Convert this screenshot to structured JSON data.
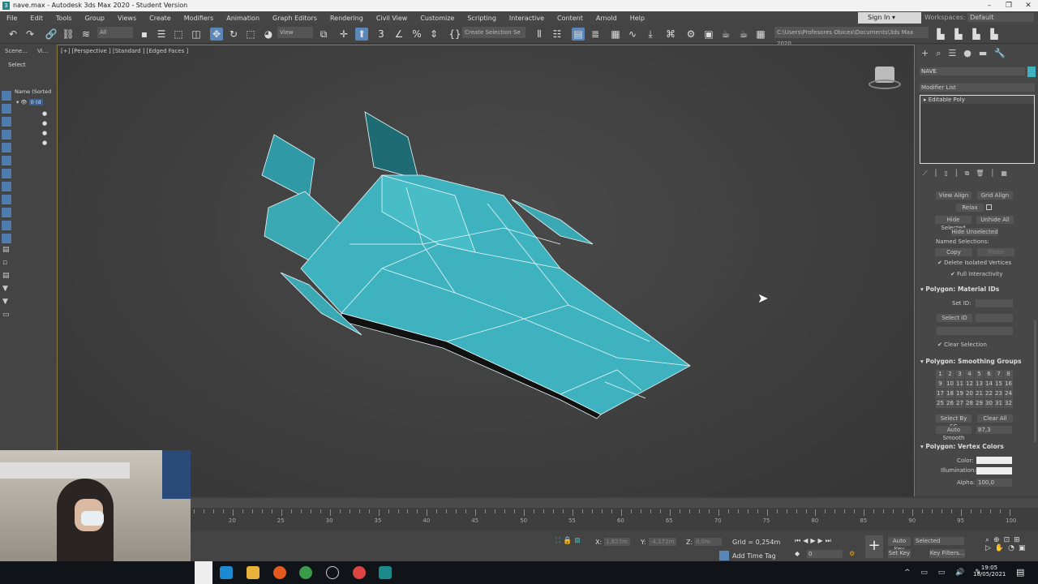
{
  "window": {
    "title": "nave.max - Autodesk 3ds Max 2020 - Student Version",
    "app_icon": "3"
  },
  "menu": [
    "File",
    "Edit",
    "Tools",
    "Group",
    "Views",
    "Create",
    "Modifiers",
    "Animation",
    "Graph Editors",
    "Rendering",
    "Civil View",
    "Customize",
    "Scripting",
    "Interactive",
    "Content",
    "Arnold",
    "Help"
  ],
  "account": {
    "sign_in": "Sign In",
    "workspaces_label": "Workspaces:",
    "workspace": "Default"
  },
  "toolbar": {
    "filter": "All",
    "ref_coord": "View",
    "selection_set": "Create Selection Se",
    "project_path": "C:\\Users\\Profesores Obicex\\Documents\\3ds Max 2020"
  },
  "left": {
    "tabs": [
      "Scene...",
      "Vi..."
    ],
    "select_label": "Select",
    "column_header": "Name (Sorted",
    "layer": "0 (d"
  },
  "viewport": {
    "label": "[+] [Perspective ] [Standard ] [Edged Faces ]",
    "object_color": "#3eb3bf"
  },
  "command_panel": {
    "object_name": "NAVE",
    "object_color": "#3eb3bf",
    "modifier_list": "Modifier List",
    "stack": [
      "Editable Poly"
    ],
    "buttons": {
      "view_align": "View Align",
      "grid_align": "Grid Align",
      "relax": "Relax",
      "hide_selected": "Hide Selected",
      "unhide_all": "Unhide All",
      "hide_unselected": "Hide Unselected",
      "named_selections": "Named Selections:",
      "copy": "Copy",
      "paste": "Paste",
      "delete_isolated": "Delete Isolated Vertices",
      "full_interactivity": "Full Interactivity"
    },
    "material_ids": {
      "title": "Polygon: Material IDs",
      "set_id": "Set ID:",
      "select_id": "Select ID",
      "clear_selection": "Clear Selection"
    },
    "smoothing": {
      "title": "Polygon: Smoothing Groups",
      "groups": [
        "1",
        "2",
        "3",
        "4",
        "5",
        "6",
        "7",
        "8",
        "9",
        "10",
        "11",
        "12",
        "13",
        "14",
        "15",
        "16",
        "17",
        "18",
        "19",
        "20",
        "21",
        "22",
        "23",
        "24",
        "25",
        "26",
        "27",
        "28",
        "29",
        "30",
        "31",
        "32"
      ],
      "select_by_sg": "Select By SG",
      "clear_all": "Clear All",
      "auto_smooth": "Auto Smooth",
      "auto_smooth_value": "87,3"
    },
    "vertex_colors": {
      "title": "Polygon: Vertex Colors",
      "color": "Color:",
      "illumination": "Illumination:",
      "alpha": "Alpha:",
      "alpha_value": "100,0"
    }
  },
  "timeline": {
    "ticks": [
      "20",
      "25",
      "30",
      "35",
      "40",
      "45",
      "50",
      "55",
      "60",
      "65",
      "70",
      "75",
      "80",
      "85",
      "90",
      "95",
      "100"
    ]
  },
  "status": {
    "x_label": "X:",
    "x": "1,827m",
    "y_label": "Y:",
    "y": "-4,172m",
    "z_label": "Z:",
    "z": "0,0m",
    "grid": "Grid = 0,254m",
    "add_time_tag": "Add Time Tag",
    "frame": "0",
    "auto_key": "Auto Key",
    "set_key": "Set Key",
    "key_mode": "Selected",
    "key_filters": "Key Filters..."
  },
  "taskbar": {
    "time": "19:05",
    "date": "18/05/2021"
  }
}
